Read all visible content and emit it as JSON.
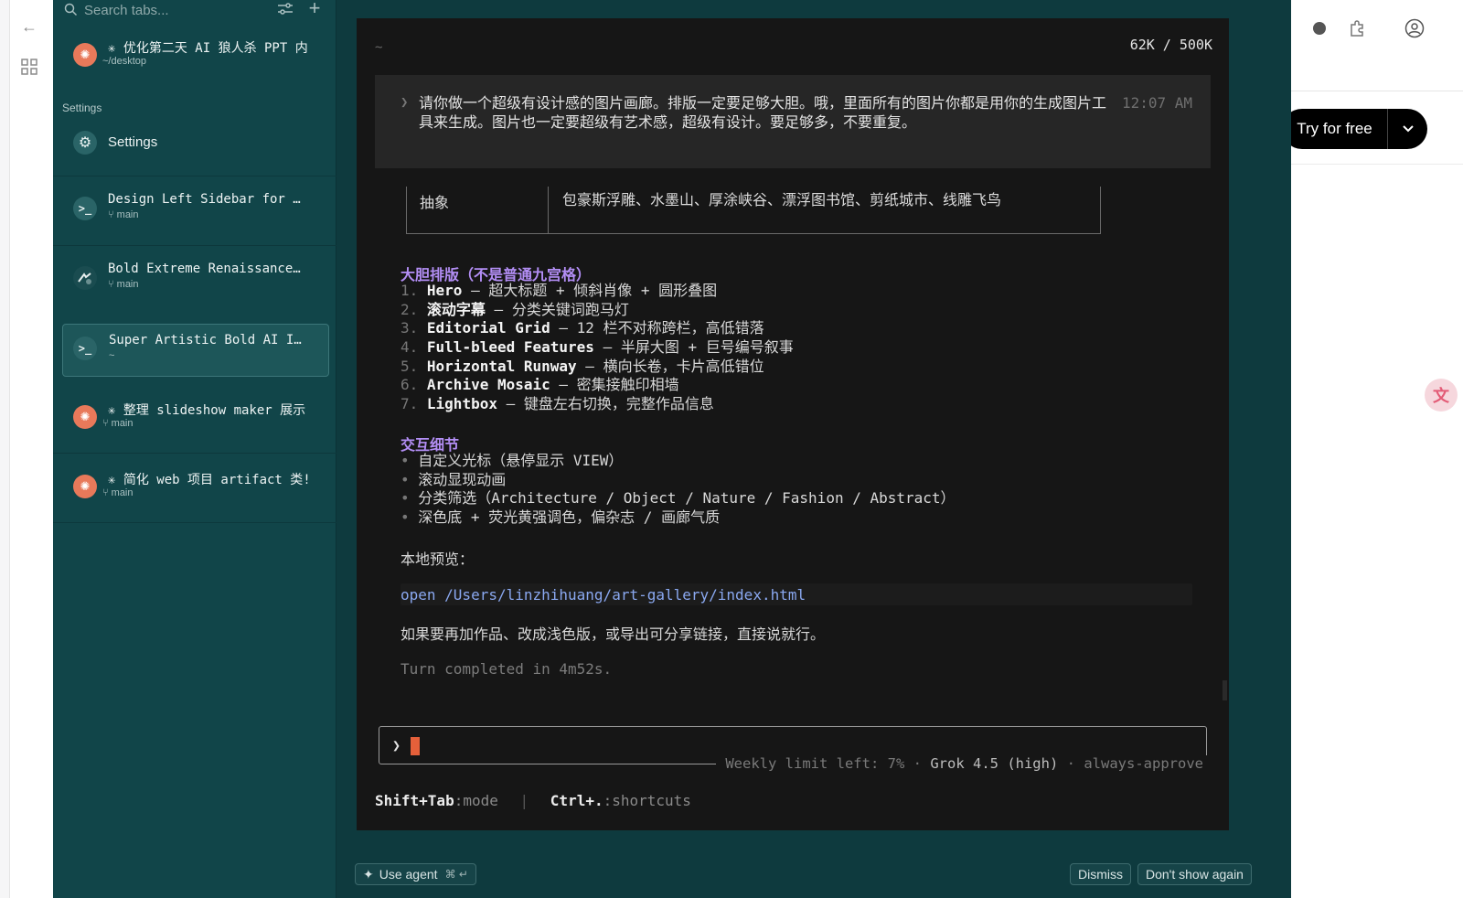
{
  "browser": {
    "try_button": "Try for free"
  },
  "sidebar": {
    "search_placeholder": "Search tabs...",
    "section_settings": "Settings",
    "items": [
      {
        "title": "✳ 优化第二天 AI 狼人杀 PPT 内",
        "sub": "~/desktop"
      },
      {
        "title": "Settings",
        "sub": ""
      },
      {
        "title": "Design Left Sidebar for …",
        "sub": "main"
      },
      {
        "title": "Bold Extreme Renaissance…",
        "sub": "main"
      },
      {
        "title": "Super Artistic Bold AI I…",
        "sub": "~"
      },
      {
        "title": "✳ 整理 slideshow maker 展示",
        "sub": "main"
      },
      {
        "title": "✳ 简化 web 项目 artifact 类!",
        "sub": "main"
      }
    ]
  },
  "terminal": {
    "cwd": "~",
    "tokens": "62K / 500K",
    "user_message": "请你做一个超级有设计感的图片画廊。排版一定要足够大胆。哦，里面所有的图片你都是用你的生成图片工具来生成。图片也一定要超级有艺术感，超级有设计。要足够多，不要重复。",
    "user_time": "12:07 AM",
    "table_row": {
      "left": "抽象",
      "right": "包豪斯浮雕、水墨山、厚涂峡谷、漂浮图书馆、剪纸城市、线雕飞鸟"
    },
    "layout_heading": "大胆排版（不是普通九宫格）",
    "layout_items": [
      {
        "num": "1.",
        "name": "Hero",
        "desc": " — 超大标题 + 倾斜肖像 + 圆形叠图"
      },
      {
        "num": "2.",
        "name": "滚动字幕",
        "desc": " — 分类关键词跑马灯"
      },
      {
        "num": "3.",
        "name": "Editorial Grid",
        "desc": " — 12 栏不对称跨栏，高低错落"
      },
      {
        "num": "4.",
        "name": "Full-bleed Features",
        "desc": " — 半屏大图 + 巨号编号叙事"
      },
      {
        "num": "5.",
        "name": "Horizontal Runway",
        "desc": " — 横向长卷，卡片高低错位"
      },
      {
        "num": "6.",
        "name": "Archive Mosaic",
        "desc": " — 密集接触印相墙"
      },
      {
        "num": "7.",
        "name": "Lightbox",
        "desc": " — 键盘左右切换，完整作品信息"
      }
    ],
    "interaction_heading": "交互细节",
    "interaction_items": [
      "自定义光标（悬停显示 VIEW）",
      "滚动显现动画",
      "分类筛选（Architecture / Object / Nature / Fashion / Abstract）",
      "深色底 + 荧光黄强调色，偏杂志 / 画廊气质"
    ],
    "preview_label": "本地预览：",
    "open_command": "open /Users/linzhihuang/art-gallery/index.html",
    "closing": "如果要再加作品、改成浅色版，或导出可分享链接，直接说就行。",
    "turn_completed": "Turn completed in 4m52s.",
    "status": {
      "weekly": "Weekly limit left: 7%",
      "model": "Grok 4.5 (high)",
      "mode": "always-approve",
      "sep": "·"
    },
    "hints": [
      {
        "key": "Shift+Tab",
        "label": ":mode"
      },
      {
        "key": "Ctrl+.",
        "label": ":shortcuts"
      }
    ]
  },
  "bottom_bar": {
    "use_agent": "Use agent",
    "use_agent_kbd": "⌘ ↵",
    "dismiss": "Dismiss",
    "dont_show": "Don't show again"
  },
  "colors": {
    "sidebar_bg": "#114549",
    "terminal_bg": "#161616",
    "heading_purple": "#b38ef5",
    "link_blue": "#8aa8f0",
    "cursor_orange": "#e5603a"
  }
}
